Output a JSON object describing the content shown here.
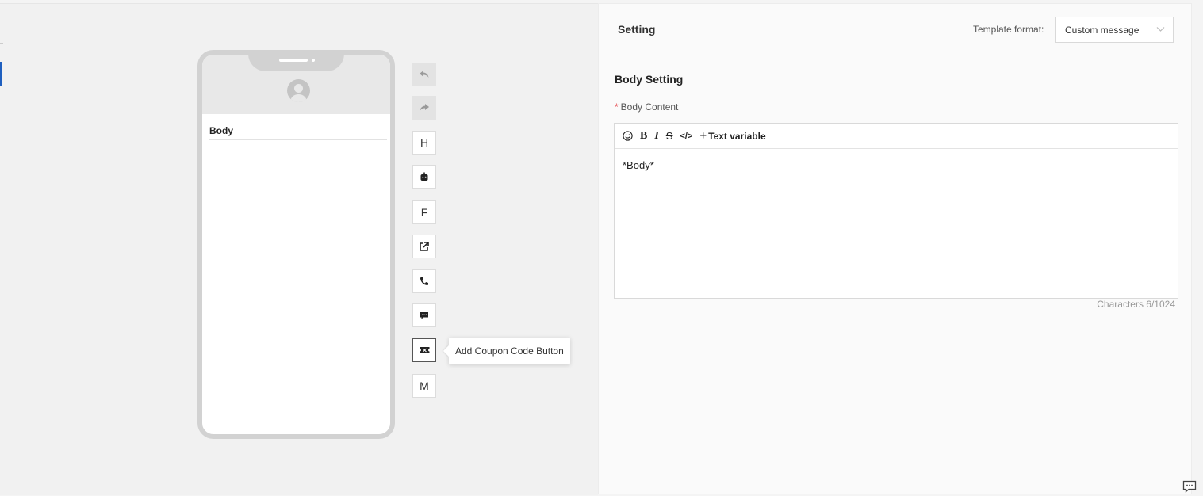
{
  "phone_preview": {
    "body_label": "Body"
  },
  "toolbar_buttons": [
    {
      "name": "undo",
      "icon": "undo-icon"
    },
    {
      "name": "redo",
      "icon": "redo-icon"
    },
    {
      "name": "header",
      "label": "H"
    },
    {
      "name": "bot",
      "icon": "bot-icon"
    },
    {
      "name": "footer",
      "label": "F"
    },
    {
      "name": "url-button",
      "icon": "external-link-icon"
    },
    {
      "name": "phone-button",
      "icon": "phone-icon"
    },
    {
      "name": "quick-reply",
      "icon": "message-icon"
    },
    {
      "name": "coupon-code",
      "icon": "ticket-icon"
    },
    {
      "name": "media",
      "label": "M"
    }
  ],
  "tooltip": {
    "text": "Add Coupon Code Button"
  },
  "settings": {
    "title": "Setting",
    "template_format_label": "Template format:",
    "template_format_value": "Custom message"
  },
  "body_setting": {
    "title": "Body Setting",
    "content_label": "Body Content",
    "required_mark": "*",
    "editor_toolbar": {
      "emoji": "emoji-icon",
      "bold": "B",
      "italic": "I",
      "strike": "S",
      "code": "</>",
      "variable_plus": "+",
      "variable_label": "Text variable"
    },
    "content": "*Body*",
    "char_count": "Characters 6/1024"
  },
  "colors": {
    "accent": "#1f5fbf",
    "required": "#e5484d"
  }
}
